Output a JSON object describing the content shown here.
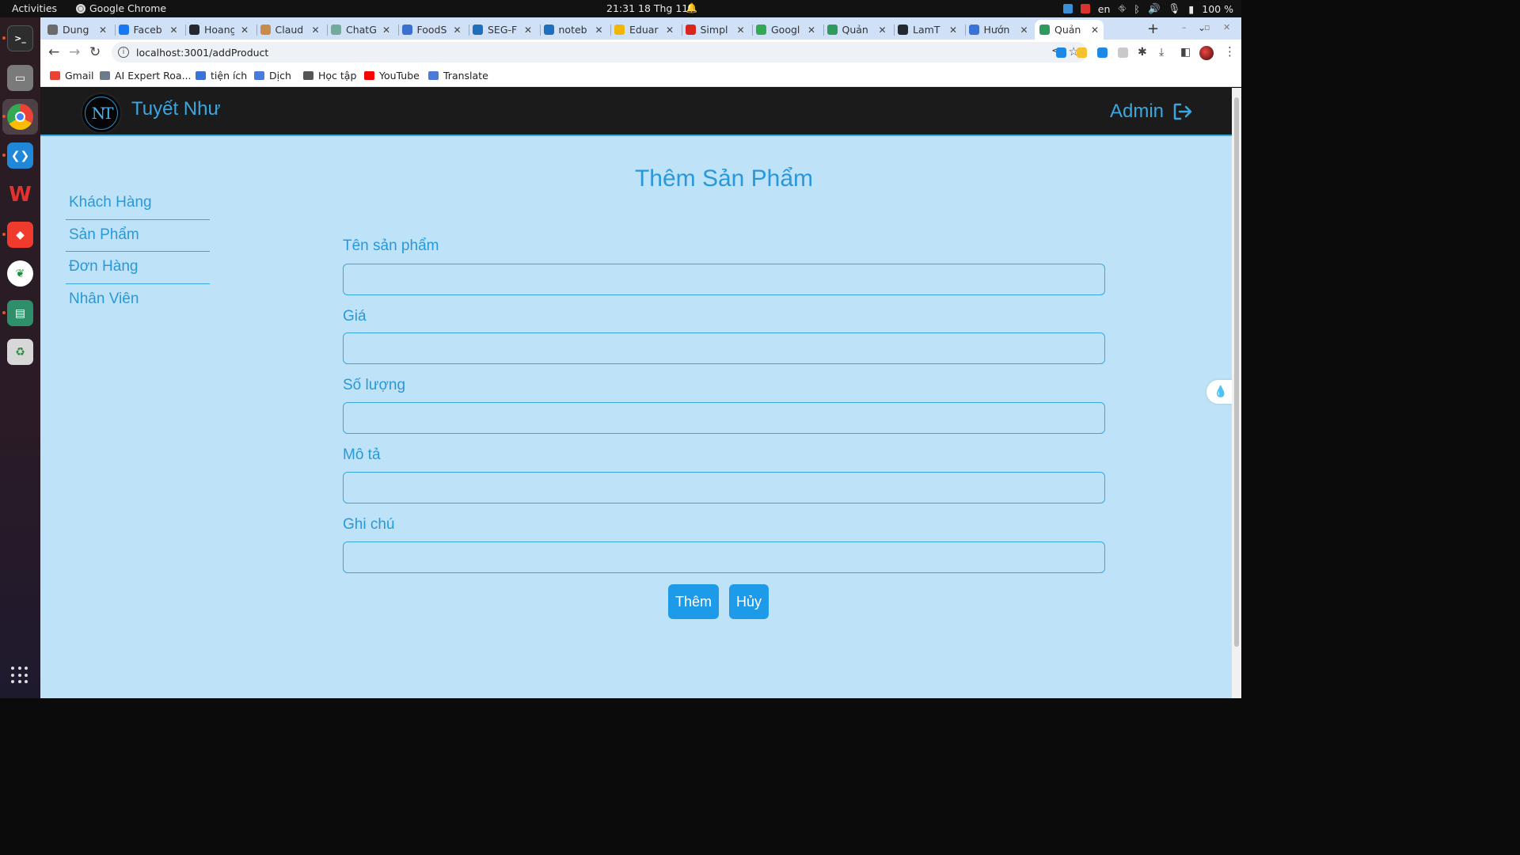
{
  "system": {
    "activities": "Activities",
    "app_name": "Google Chrome",
    "clock": "21:31  18 Thg 11",
    "lang": "en",
    "battery": "100 %"
  },
  "browser": {
    "tabs": [
      {
        "title": "Dung",
        "color": "#6b6b6b"
      },
      {
        "title": "Faceb",
        "color": "#1877f2"
      },
      {
        "title": "Hoang",
        "color": "#24292f"
      },
      {
        "title": "Claud",
        "color": "#c98b4a"
      },
      {
        "title": "ChatG",
        "color": "#74aa9c"
      },
      {
        "title": "FoodS",
        "color": "#3b6fd1"
      },
      {
        "title": "SEG-F",
        "color": "#1f6fbf"
      },
      {
        "title": "noteb",
        "color": "#1f6fbf"
      },
      {
        "title": "Eduar",
        "color": "#f2b705"
      },
      {
        "title": "Simpl",
        "color": "#d9261c"
      },
      {
        "title": "Googl",
        "color": "#34a853"
      },
      {
        "title": "Quản",
        "color": "#2e9a5e"
      },
      {
        "title": "LamT",
        "color": "#24292f"
      },
      {
        "title": "Hướn",
        "color": "#3b73d4"
      },
      {
        "title": "Quản",
        "color": "#2e9a5e"
      }
    ],
    "url": "localhost:3001/addProduct",
    "bookmarks": [
      {
        "label": "Gmail",
        "color": "#ea4335"
      },
      {
        "label": "AI Expert Roa...",
        "color": "#6c7a89"
      },
      {
        "label": "tiện ích",
        "color": "#3b73d4"
      },
      {
        "label": "Dịch",
        "color": "#4a7bd8"
      },
      {
        "label": "Học tập",
        "color": "#555555"
      },
      {
        "label": "YouTube",
        "color": "#ff0000"
      },
      {
        "label": "Translate",
        "color": "#4a7bd8"
      }
    ]
  },
  "header": {
    "brand": "Tuyết Như",
    "logo_text": "NT",
    "admin_label": "Admin"
  },
  "sidebar": {
    "items": [
      {
        "label": "Khách Hàng"
      },
      {
        "label": "Sản Phẩm"
      },
      {
        "label": "Đơn Hàng"
      },
      {
        "label": "Nhân Viên"
      }
    ]
  },
  "form": {
    "title": "Thêm Sản Phẩm",
    "fields": [
      {
        "label": "Tên sản phẩm",
        "value": ""
      },
      {
        "label": "Giá",
        "value": ""
      },
      {
        "label": "Số lượng",
        "value": ""
      },
      {
        "label": "Mô tả",
        "value": ""
      },
      {
        "label": "Ghi chú",
        "value": ""
      }
    ],
    "submit_label": "Thêm",
    "cancel_label": "Hủy"
  },
  "colors": {
    "accent": "#3aa7e0",
    "page_bg": "#bee3f8",
    "header_bg": "#1b1b1b",
    "button_bg": "#1e9be8"
  }
}
